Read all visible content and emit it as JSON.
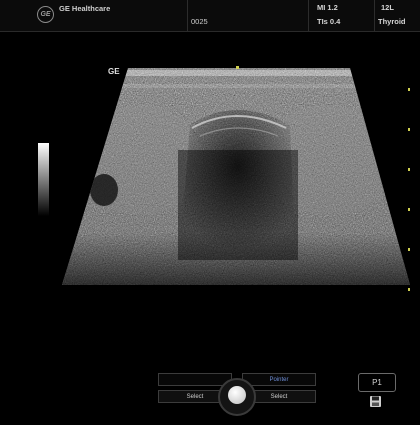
{
  "header": {
    "brand": "GE Healthcare",
    "logo_text": "GE",
    "image_number": "0025",
    "mi_text": "MI 1.2",
    "tis_text": "TIs 0.4",
    "probe": "12L",
    "preset": "Thyroid"
  },
  "image_area": {
    "orientation_label": "GE",
    "gray_scale_bar": "grayscale-bar"
  },
  "controls": {
    "left_top_label": "",
    "left_bottom_label": "Select",
    "right_top_label": "Pointer",
    "right_bottom_label": "Select",
    "p1_label": "P1",
    "save_icon": "save-icon",
    "knob_icon": "trackball-icon"
  },
  "colors": {
    "background": "#000000",
    "pointer_label": "#6f8fd8",
    "marker": "#cfcf50"
  }
}
